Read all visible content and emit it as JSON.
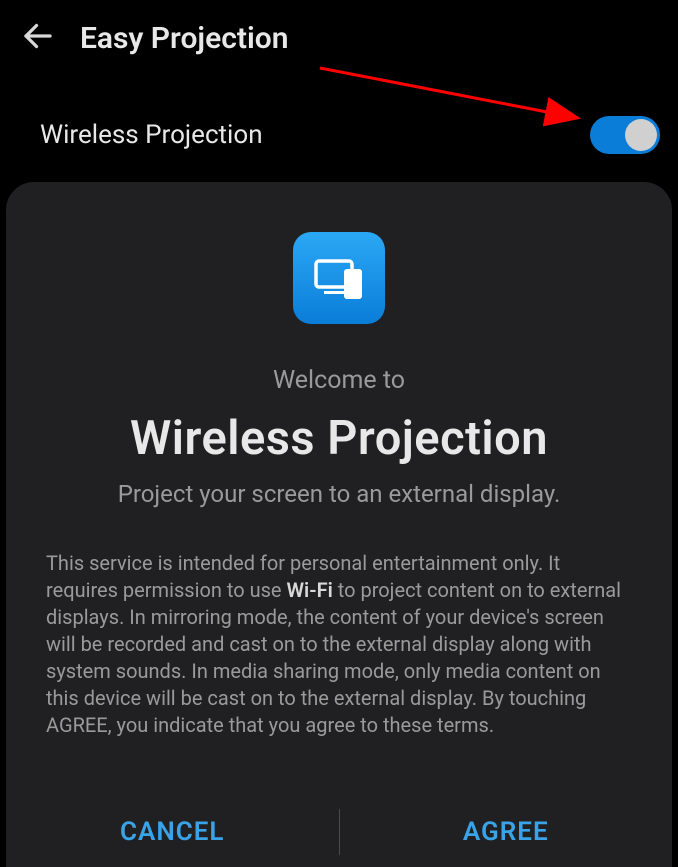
{
  "header": {
    "title": "Easy Projection"
  },
  "toggle": {
    "label": "Wireless Projection",
    "state": "on"
  },
  "dialog": {
    "welcome": "Welcome to",
    "title": "Wireless Projection",
    "subtitle": "Project your screen to an external display.",
    "terms_pre": "This service is intended for personal entertainment only. It requires permission to use ",
    "terms_bold": "Wi-Fi",
    "terms_post": " to project content on to external displays. In mirroring mode, the content of your device's screen will be recorded and cast on to the external display along with system sounds. In media sharing mode, only media content on this device will be cast on to the external display. By touching AGREE, you indicate that you agree to these terms.",
    "cancel": "CANCEL",
    "agree": "AGREE"
  },
  "colors": {
    "accent": "#0a7dd8",
    "annotation": "#ff0000"
  }
}
